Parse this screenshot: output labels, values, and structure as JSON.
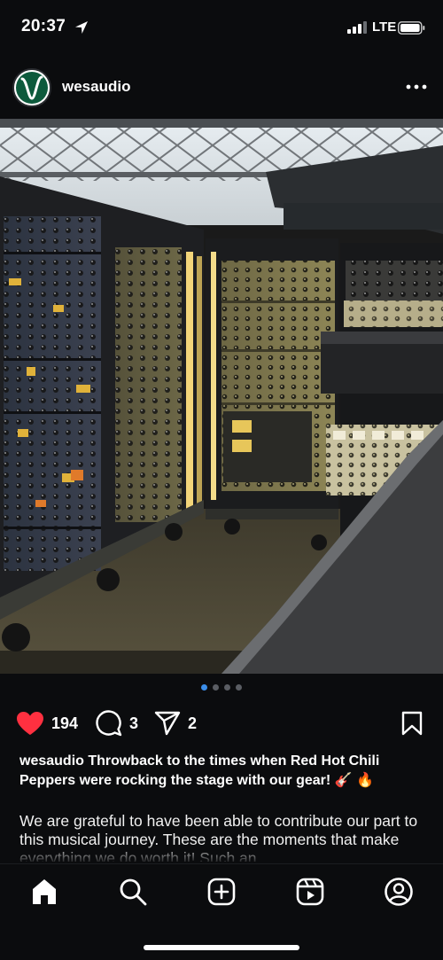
{
  "status": {
    "time": "20:37",
    "carrier": "LTE"
  },
  "post": {
    "username": "wesaudio",
    "likes": "194",
    "comments": "3",
    "shares": "2",
    "carousel_total": 4,
    "carousel_active": 1,
    "caption_username": "wesaudio",
    "caption_title": "Throwback to the times when Red Hot Chili Peppers were rocking the stage with our gear! 🎸 🔥",
    "caption_body": "We are grateful to have been able to contribute our part to this musical journey. These are the moments that make everything we do worth it! Such an"
  },
  "icons": {
    "location": "location-arrow-icon",
    "signal": "signal-bars-icon",
    "battery": "battery-icon",
    "more": "more-options-icon",
    "like": "heart-icon",
    "comment": "comment-icon",
    "share": "share-icon",
    "save": "bookmark-icon",
    "home": "home-icon",
    "search": "search-icon",
    "create": "create-icon",
    "reels": "reels-icon",
    "profile": "profile-icon"
  },
  "colors": {
    "like": "#ff3040",
    "active_dot": "#3b8eea",
    "background": "#0b0c0e"
  }
}
